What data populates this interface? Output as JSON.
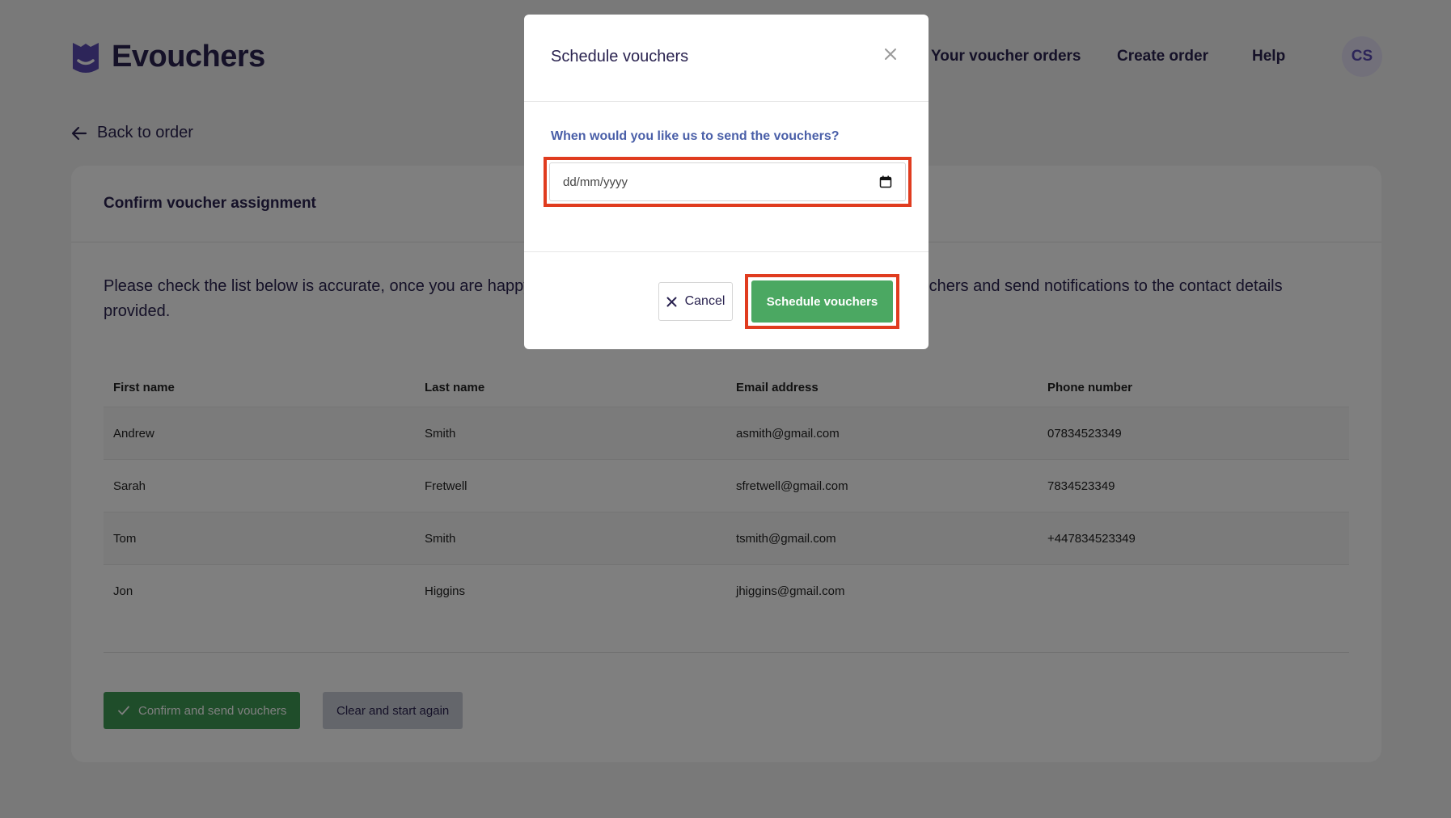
{
  "header": {
    "brand": "Evouchers",
    "nav": {
      "orders": "Your voucher orders",
      "create": "Create order",
      "help": "Help"
    },
    "avatar_initials": "CS"
  },
  "back_link": "Back to order",
  "card": {
    "title": "Confirm voucher assignment",
    "description": "Please check the list below is accurate, once you are happy to go ahead, click the button below to generate the vouchers and send notifications to the contact details provided.",
    "table": {
      "headers": [
        "First name",
        "Last name",
        "Email address",
        "Phone number"
      ],
      "rows": [
        [
          "Andrew",
          "Smith",
          "asmith@gmail.com",
          "07834523349"
        ],
        [
          "Sarah",
          "Fretwell",
          "sfretwell@gmail.com",
          "7834523349"
        ],
        [
          "Tom",
          "Smith",
          "tsmith@gmail.com",
          "+447834523349"
        ],
        [
          "Jon",
          "Higgins",
          "jhiggins@gmail.com",
          ""
        ]
      ]
    },
    "confirm_button": "Confirm and send vouchers",
    "clear_button": "Clear and start again"
  },
  "modal": {
    "title": "Schedule vouchers",
    "question": "When would you like us to send the vouchers?",
    "date_placeholder": "dd/mm/yyyy",
    "cancel_label": "Cancel",
    "schedule_label": "Schedule vouchers"
  },
  "colors": {
    "brand": "#5a4bb3",
    "primary_green": "#4ba862",
    "highlight": "#e03c1f"
  }
}
